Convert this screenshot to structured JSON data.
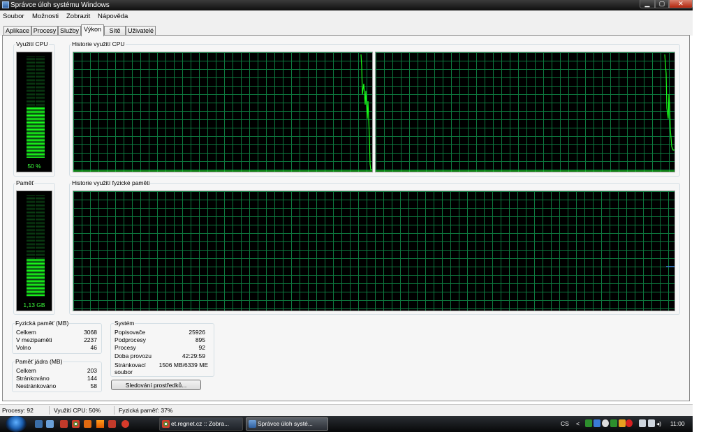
{
  "window": {
    "title": "Správce úloh systému Windows",
    "min": "▁",
    "max": "▢",
    "close": "✕"
  },
  "menu": [
    "Soubor",
    "Možnosti",
    "Zobrazit",
    "Nápověda"
  ],
  "tabs": [
    "Aplikace",
    "Procesy",
    "Služby",
    "Výkon",
    "Sítě",
    "Uživatelé"
  ],
  "active_tab": "Výkon",
  "cpu": {
    "label": "Využití CPU",
    "value_text": "50 %",
    "usage_fraction": 0.5
  },
  "cpu_history": {
    "label": "Historie využití CPU",
    "cores": 2
  },
  "memory": {
    "label": "Paměť",
    "value_text": "1,13 GB",
    "usage_fraction": 0.37
  },
  "memory_history": {
    "label": "Historie využití fyzické paměti"
  },
  "physical_memory": {
    "label": "Fyzická paměť (MB)",
    "rows": [
      {
        "name": "Celkem",
        "value": "3068"
      },
      {
        "name": "V mezipaměti",
        "value": "2237"
      },
      {
        "name": "Volno",
        "value": "46"
      }
    ]
  },
  "kernel_memory": {
    "label": "Paměť jádra (MB)",
    "rows": [
      {
        "name": "Celkem",
        "value": "203"
      },
      {
        "name": "Stránkováno",
        "value": "144"
      },
      {
        "name": "Nestránkováno",
        "value": "58"
      }
    ]
  },
  "system": {
    "label": "Systém",
    "rows": [
      {
        "name": "Popisovače",
        "value": "25926"
      },
      {
        "name": "Podprocesy",
        "value": "895"
      },
      {
        "name": "Procesy",
        "value": "92"
      },
      {
        "name": "Doba provozu",
        "value": "42:29:59"
      },
      {
        "name": "Stránkovací",
        "name2": "soubor",
        "value": "1506 MB/6339 ME"
      }
    ]
  },
  "resource_monitor_button": "Sledování prostředků...",
  "status": {
    "processes": "Procesy: 92",
    "cpu": "Využití CPU: 50%",
    "memory": "Fyzická paměť: 37%"
  },
  "taskbar": {
    "tasks": [
      {
        "label": "et.regnet.cz :: Zobra...",
        "icon": "chrome-icon"
      },
      {
        "label": "Správce úloh systé...",
        "icon": "task-manager-icon"
      }
    ],
    "lang": "CS",
    "clock": "11:00"
  },
  "colors": {
    "graph_bg": "#000000",
    "grid": "#0d7a3f",
    "cpu_line": "#19ff19",
    "mem_line": "#3d7bd9",
    "meter_label": "#3cff3c"
  }
}
